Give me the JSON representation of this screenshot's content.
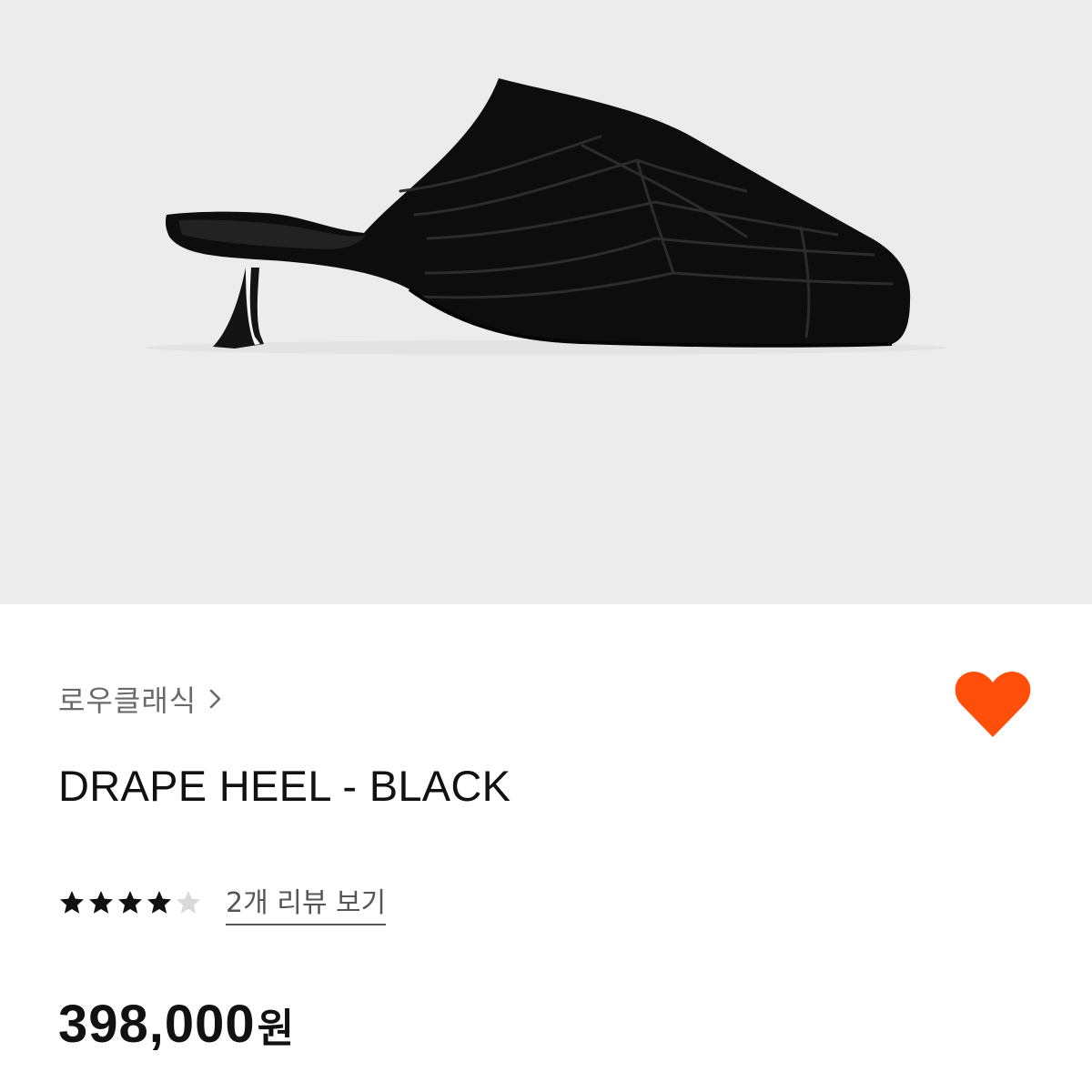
{
  "product_image": {
    "icon": "shoe-product-image",
    "background": "#ececed"
  },
  "brand": {
    "name": "로우클래식",
    "chevron_icon": "chevron-right-icon"
  },
  "like": {
    "icon": "heart-icon",
    "color": "#ff4f0a"
  },
  "product": {
    "title": "DRAPE HEEL - BLACK"
  },
  "rating": {
    "stars": 4,
    "max_stars": 5,
    "filled_color": "#111111",
    "empty_color": "#d9d9d9",
    "review_link": "2개 리뷰 보기"
  },
  "price": {
    "amount": "398,000",
    "unit": "원"
  }
}
